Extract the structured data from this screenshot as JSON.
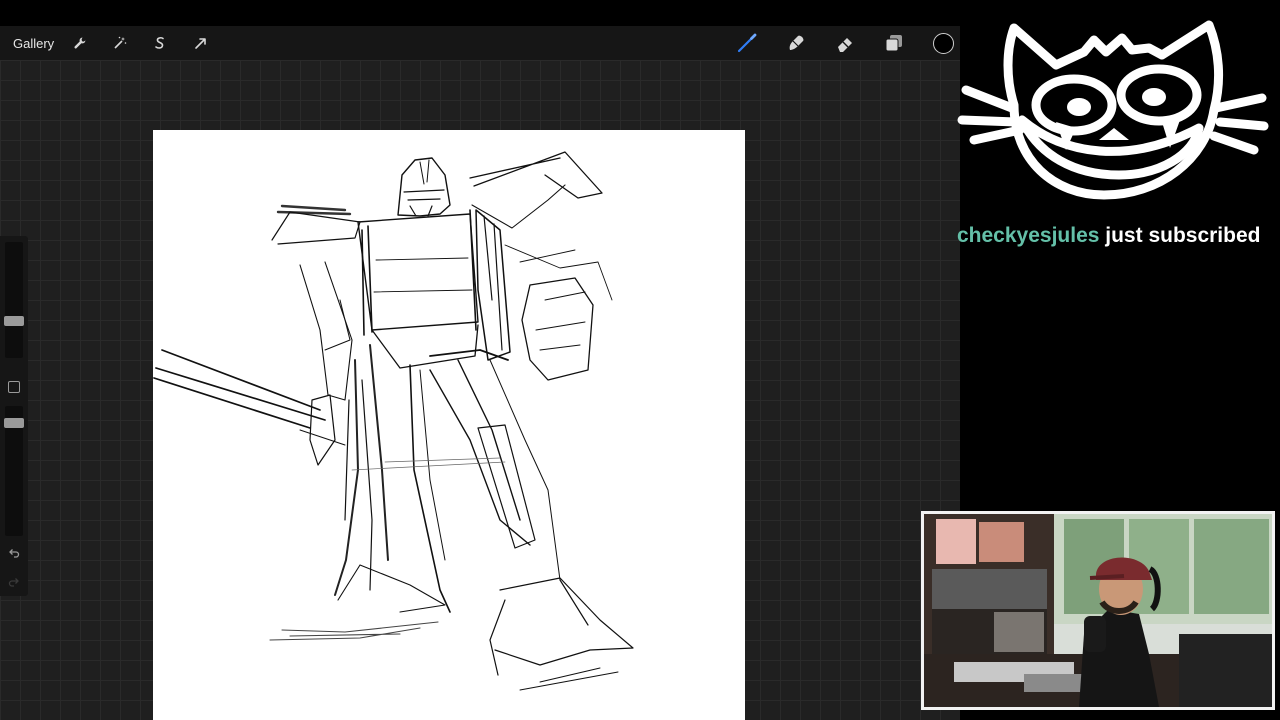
{
  "toolbar": {
    "gallery_label": "Gallery",
    "left_tools": [
      "wrench-icon",
      "magic-wand-icon",
      "selection-icon",
      "transform-arrow-icon"
    ],
    "right_tools": [
      "brush-icon",
      "smudge-icon",
      "eraser-icon",
      "layers-icon"
    ],
    "brush_color": "#2f7df6",
    "current_color": "#000000"
  },
  "sidebar": {
    "controls": [
      "brush-size-slider",
      "modify-button",
      "opacity-slider",
      "undo-icon",
      "redo-icon"
    ]
  },
  "overlay": {
    "logo": "cat-face-logo",
    "alert": {
      "username": "checkyesjules",
      "message": " just subscribed",
      "username_color": "#64c0a8"
    },
    "webcam": "webcam-feed"
  },
  "colors": {
    "canvas_background": "#1f1f1f",
    "toolbar": "#161616",
    "paper": "#ffffff"
  }
}
